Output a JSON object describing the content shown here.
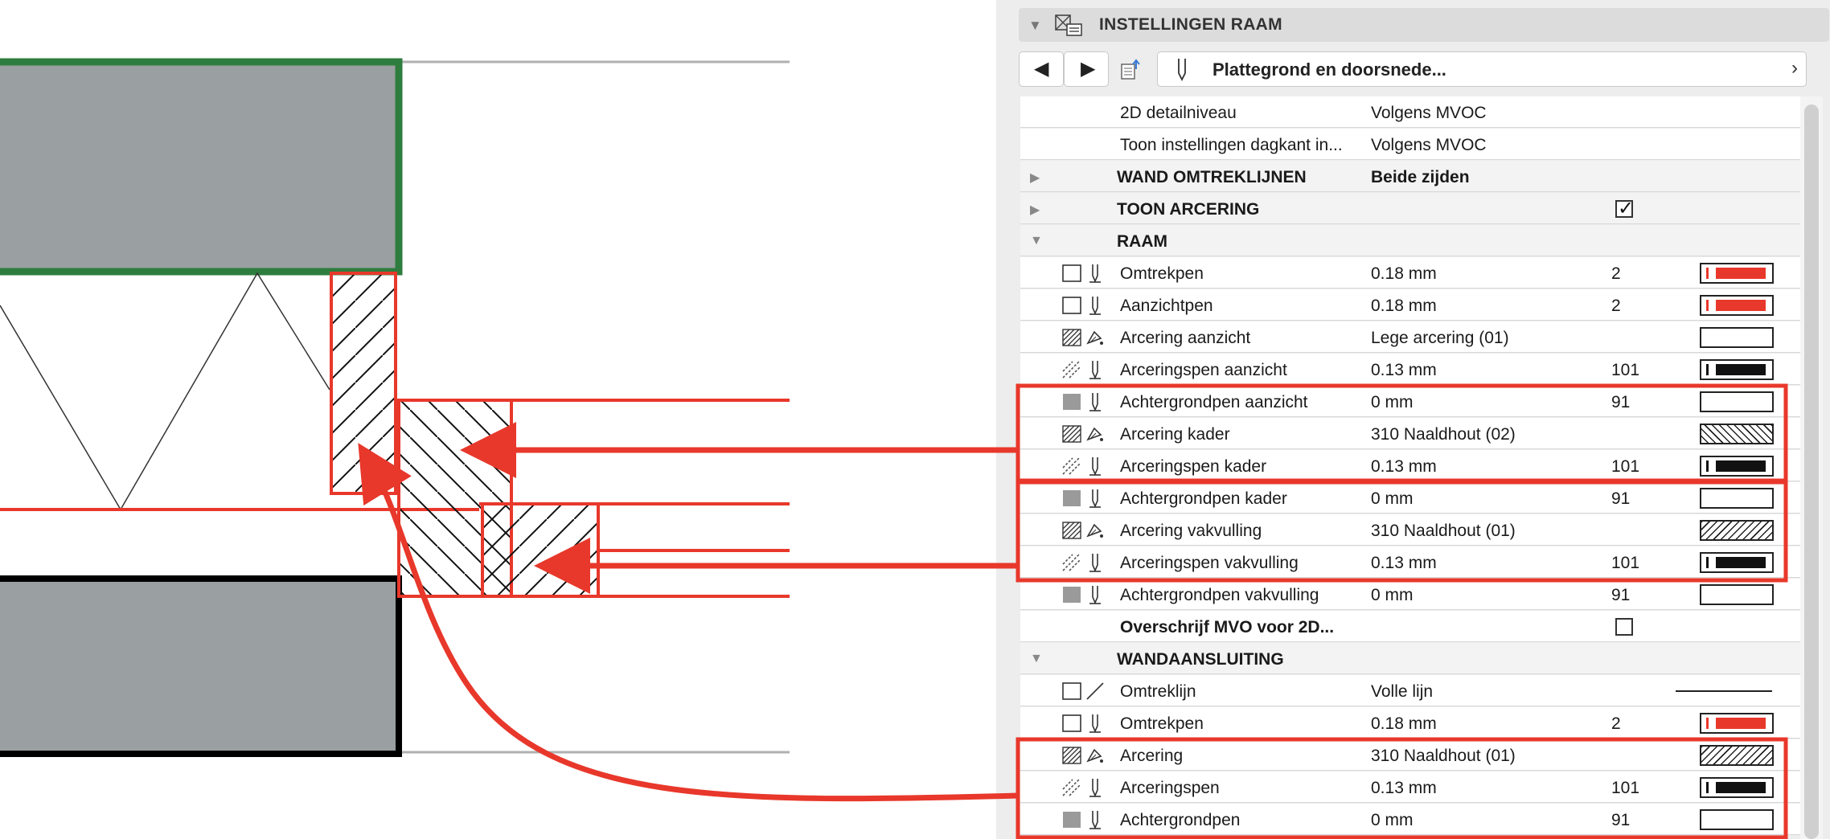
{
  "panel": {
    "title": "INSTELLINGEN RAAM",
    "nav_label": "Plattegrond en doorsnede...",
    "accent": "#e8382b"
  },
  "rows": [
    {
      "kind": "plain",
      "name": "2D detailniveau",
      "value": "Volgens MVOC"
    },
    {
      "kind": "plain",
      "name": "Toon instellingen dagkant in...",
      "value": "Volgens MVOC"
    },
    {
      "kind": "section-collapsed",
      "name": "WAND OMTREKLIJNEN",
      "value": "Beide zijden"
    },
    {
      "kind": "section-collapsed",
      "name": "TOON ARCERING",
      "value": "",
      "checked": true
    },
    {
      "kind": "section-open",
      "name": "RAAM",
      "value": ""
    },
    {
      "kind": "item",
      "icon1": "empty-box",
      "icon2": "pen",
      "name": "Omtrekpen",
      "value": "0.18 mm",
      "num": "2",
      "swatch": "red-pen"
    },
    {
      "kind": "item",
      "icon1": "empty-box",
      "icon2": "pen",
      "name": "Aanzichtpen",
      "value": "0.18 mm",
      "num": "2",
      "swatch": "red-pen"
    },
    {
      "kind": "item",
      "icon1": "hatch-box",
      "icon2": "fill-brush",
      "name": "Arcering aanzicht",
      "value": "Lege arcering (01)",
      "num": "",
      "swatch": "empty"
    },
    {
      "kind": "item",
      "icon1": "hatch-lines",
      "icon2": "pen",
      "name": "Arceringspen aanzicht",
      "value": "0.13 mm",
      "num": "101",
      "swatch": "black-pen"
    },
    {
      "kind": "item",
      "icon1": "grey-box",
      "icon2": "pen",
      "name": "Achtergrondpen aanzicht",
      "value": "0 mm",
      "num": "91",
      "swatch": "empty"
    },
    {
      "kind": "item",
      "icon1": "hatch-box",
      "icon2": "fill-brush",
      "name": "Arcering kader",
      "value": "310 Naaldhout (02)",
      "num": "",
      "swatch": "hatch-back"
    },
    {
      "kind": "item",
      "icon1": "hatch-lines",
      "icon2": "pen",
      "name": "Arceringspen kader",
      "value": "0.13 mm",
      "num": "101",
      "swatch": "black-pen"
    },
    {
      "kind": "item",
      "icon1": "grey-box",
      "icon2": "pen",
      "name": "Achtergrondpen kader",
      "value": "0 mm",
      "num": "91",
      "swatch": "empty"
    },
    {
      "kind": "item",
      "icon1": "hatch-box",
      "icon2": "fill-brush",
      "name": "Arcering vakvulling",
      "value": "310 Naaldhout (01)",
      "num": "",
      "swatch": "hatch-fwd"
    },
    {
      "kind": "item",
      "icon1": "hatch-lines",
      "icon2": "pen",
      "name": "Arceringspen vakvulling",
      "value": "0.13 mm",
      "num": "101",
      "swatch": "black-pen"
    },
    {
      "kind": "item",
      "icon1": "grey-box",
      "icon2": "pen",
      "name": "Achtergrondpen vakvulling",
      "value": "0 mm",
      "num": "91",
      "swatch": "empty"
    },
    {
      "kind": "bold-check",
      "name": "Overschrijf MVO voor 2D...",
      "value": "",
      "checked": false
    },
    {
      "kind": "section-open",
      "name": "WANDAANSLUITING",
      "value": ""
    },
    {
      "kind": "item",
      "icon1": "empty-box",
      "icon2": "line",
      "name": "Omtreklijn",
      "value": "Volle lijn",
      "num": "",
      "swatch": "line"
    },
    {
      "kind": "item",
      "icon1": "empty-box",
      "icon2": "pen",
      "name": "Omtrekpen",
      "value": "0.18 mm",
      "num": "2",
      "swatch": "red-pen"
    },
    {
      "kind": "item",
      "icon1": "hatch-box",
      "icon2": "fill-brush",
      "name": "Arcering",
      "value": "310 Naaldhout (01)",
      "num": "",
      "swatch": "hatch-fwd"
    },
    {
      "kind": "item",
      "icon1": "hatch-lines",
      "icon2": "pen",
      "name": "Arceringspen",
      "value": "0.13 mm",
      "num": "101",
      "swatch": "black-pen"
    },
    {
      "kind": "item",
      "icon1": "grey-box",
      "icon2": "pen",
      "name": "Achtergrondpen",
      "value": "0 mm",
      "num": "91",
      "swatch": "empty"
    }
  ]
}
